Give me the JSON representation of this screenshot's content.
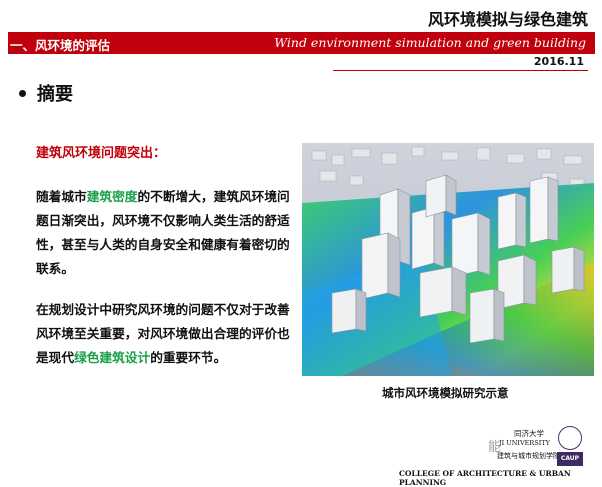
{
  "header": {
    "title": "风环境模拟与绿色建筑",
    "section": "一、风环境的评估",
    "english_title": "Wind environment simulation and green building",
    "date": "2016.11"
  },
  "content": {
    "heading": "摘要",
    "subheading": "建筑风环境问题突出：",
    "para1": {
      "pre": "随着城市",
      "highlight": "建筑密度",
      "post": "的不断增大，建筑风环境问题日渐突出，风环境不仅影响人类生活的舒适性，甚至与人类的自身安全和健康有着密切的联系。"
    },
    "para2": {
      "pre": "在规划设计中研究风环境的问题不仅对于改善风环境至关重要，对风环境做出合理的评价也是现代",
      "highlight": "绿色建筑设计",
      "post": "的重要环节。"
    },
    "caption": "城市风环境模拟研究示意"
  },
  "footer": {
    "university_cn": "同济大学",
    "university_en": "JI UNIVERSITY",
    "college_cn": "建筑与城市规划学院",
    "college_en": "COLLEGE OF ARCHITECTURE & URBAN PLANNING",
    "caup": "CAUP",
    "watermark": "能"
  },
  "colors": {
    "accent_red": "#c0000c",
    "highlight_green": "#1aa048"
  }
}
